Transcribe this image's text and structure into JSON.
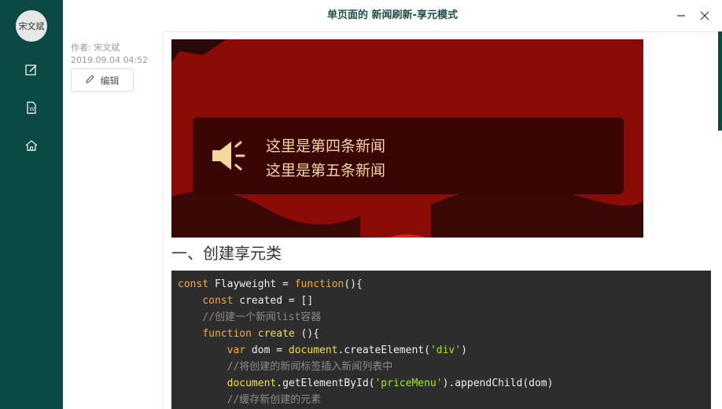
{
  "sidebar": {
    "avatar_text": "宋文斌",
    "nav": [
      {
        "icon": "edit-icon"
      },
      {
        "icon": "word-document-icon"
      },
      {
        "icon": "home-icon"
      }
    ]
  },
  "header": {
    "title": "单页面的 新闻刷新-享元模式",
    "minimize_icon": "minimize-icon",
    "close_icon": "close-icon"
  },
  "meta": {
    "author": "作者: 宋文斌",
    "date": "2019.09.04 04:52",
    "edit_label": "编辑"
  },
  "banner": {
    "line1": "这里是第四条新闻",
    "line2": "这里是第五条新闻",
    "icon": "speaker-icon"
  },
  "section_heading": "一、创建享元类",
  "code_lines": [
    {
      "indent": "",
      "parts": [
        {
          "t": "const",
          "c": "kw"
        },
        {
          "t": " Flayweight = ",
          "c": "plain"
        },
        {
          "t": "function",
          "c": "kw"
        },
        {
          "t": "(){",
          "c": "plain"
        }
      ]
    },
    {
      "indent": "    ",
      "parts": [
        {
          "t": "const",
          "c": "kw"
        },
        {
          "t": " created = []",
          "c": "plain"
        }
      ]
    },
    {
      "indent": "    ",
      "parts": [
        {
          "t": "//创建一个新闻list容器",
          "c": "cm"
        }
      ]
    },
    {
      "indent": "    ",
      "parts": [
        {
          "t": "function",
          "c": "kw"
        },
        {
          "t": " ",
          "c": "plain"
        },
        {
          "t": "create",
          "c": "fn"
        },
        {
          "t": " (){",
          "c": "plain"
        }
      ]
    },
    {
      "indent": "        ",
      "parts": [
        {
          "t": "var",
          "c": "kw"
        },
        {
          "t": " dom = ",
          "c": "plain"
        },
        {
          "t": "document",
          "c": "fn"
        },
        {
          "t": ".createElement(",
          "c": "plain"
        },
        {
          "t": "'div'",
          "c": "str"
        },
        {
          "t": ")",
          "c": "plain"
        }
      ]
    },
    {
      "indent": "        ",
      "parts": [
        {
          "t": "//将创建的新闻标签插入新闻列表中",
          "c": "cm"
        }
      ]
    },
    {
      "indent": "        ",
      "parts": [
        {
          "t": "document",
          "c": "fn"
        },
        {
          "t": ".getElementById(",
          "c": "plain"
        },
        {
          "t": "'priceMenu'",
          "c": "str"
        },
        {
          "t": ").appendChild(dom)",
          "c": "plain"
        }
      ]
    },
    {
      "indent": "        ",
      "parts": [
        {
          "t": "//缓存新创建的元素",
          "c": "cm"
        }
      ]
    }
  ]
}
